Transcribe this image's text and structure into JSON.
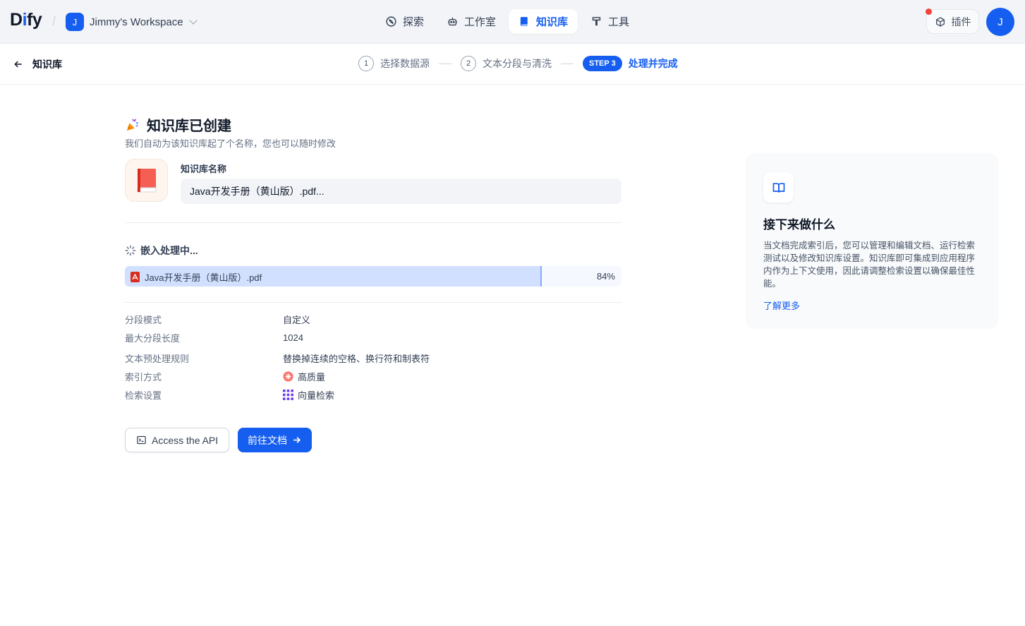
{
  "brand": {
    "logo_text_pre": "D",
    "logo_text_accent": "i",
    "logo_text_post": "fy"
  },
  "workspace": {
    "initial": "J",
    "name": "Jimmy's Workspace"
  },
  "nav": {
    "items": [
      {
        "label": "探索",
        "icon": "compass-icon"
      },
      {
        "label": "工作室",
        "icon": "robot-icon"
      },
      {
        "label": "知识库",
        "icon": "book-icon",
        "active": true
      },
      {
        "label": "工具",
        "icon": "hammer-icon"
      }
    ]
  },
  "header": {
    "plugin_label": "插件",
    "user_initial": "J"
  },
  "subheader": {
    "back_label": "知识库",
    "steps": [
      {
        "num": "1",
        "label": "选择数据源"
      },
      {
        "num": "2",
        "label": "文本分段与清洗"
      },
      {
        "num": "STEP 3",
        "label": "处理并完成",
        "active": true
      }
    ]
  },
  "main": {
    "title": "知识库已创建",
    "subtitle": "我们自动为该知识库起了个名称，您也可以随时修改",
    "name_label": "知识库名称",
    "name_value": "Java开发手册（黄山版）.pdf...",
    "embed_status": "嵌入处理中...",
    "file": {
      "name": "Java开发手册（黄山版）.pdf",
      "progress_text": "84%",
      "progress": 0.84
    },
    "info": [
      {
        "key": "分段模式",
        "value": "自定义"
      },
      {
        "key": "最大分段长度",
        "value": "1024"
      },
      {
        "key": "文本预处理规则",
        "value": "替换掉连续的空格、换行符和制表符"
      },
      {
        "key": "索引方式",
        "value": "高质量",
        "icon": "high-quality-icon"
      },
      {
        "key": "检索设置",
        "value": "向量检索",
        "icon": "vector-grid-icon"
      }
    ],
    "api_button": "Access the API",
    "docs_button": "前往文档"
  },
  "side_card": {
    "title": "接下来做什么",
    "text": "当文档完成索引后，您可以管理和编辑文档、运行检索测试以及修改知识库设置。知识库即可集成到应用程序内作为上下文使用，因此请调整检索设置以确保最佳性能。",
    "link": "了解更多"
  },
  "colors": {
    "accent": "#155eef",
    "progress_fill": "#d1e0ff",
    "alert_dot": "#f04438"
  }
}
